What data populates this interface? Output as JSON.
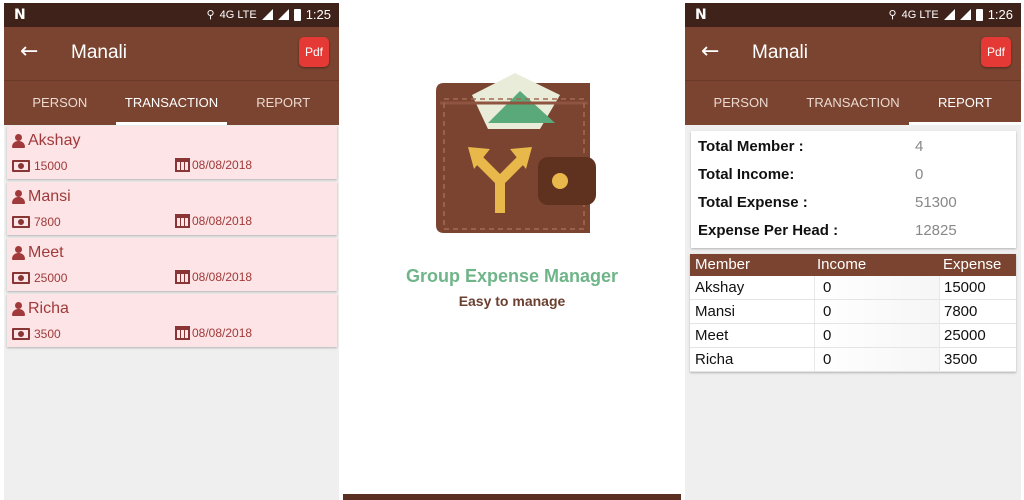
{
  "left": {
    "status": {
      "network": "4G LTE",
      "time": "1:25"
    },
    "title": "Manali",
    "pdf_label": "Pdf",
    "tabs": [
      "PERSON",
      "TRANSACTION",
      "REPORT"
    ],
    "active_tab": "TRANSACTION",
    "transactions": [
      {
        "name": "Akshay",
        "amount": "15000",
        "date": "08/08/2018"
      },
      {
        "name": "Mansi",
        "amount": "7800",
        "date": "08/08/2018"
      },
      {
        "name": "Meet",
        "amount": "25000",
        "date": "08/08/2018"
      },
      {
        "name": "Richa",
        "amount": "3500",
        "date": "08/08/2018"
      }
    ]
  },
  "middle": {
    "app_name": "Group Expense Manager",
    "tagline": "Easy to manage",
    "colors": {
      "wallet": "#7a4430",
      "arrow": "#e8b84b",
      "bill": "#5aa97a"
    }
  },
  "right": {
    "status": {
      "network": "4G LTE",
      "time": "1:26"
    },
    "title": "Manali",
    "pdf_label": "Pdf",
    "tabs": [
      "PERSON",
      "TRANSACTION",
      "REPORT"
    ],
    "active_tab": "REPORT",
    "summary": [
      {
        "label": "Total Member :",
        "value": "4"
      },
      {
        "label": "Total Income:",
        "value": "0"
      },
      {
        "label": "Total Expense :",
        "value": "51300"
      },
      {
        "label": "Expense Per Head :",
        "value": "12825"
      }
    ],
    "table": {
      "headers": [
        "Member",
        "Income",
        "Expense"
      ],
      "rows": [
        [
          "Akshay",
          "0",
          "15000"
        ],
        [
          "Mansi",
          "0",
          "7800"
        ],
        [
          "Meet",
          "0",
          "25000"
        ],
        [
          "Richa",
          "0",
          "3500"
        ]
      ]
    }
  },
  "colors": {
    "status_bar": "#3f2219",
    "app_bar": "#7a4430",
    "card": "#fde4e6",
    "pdf": "#e53935",
    "accent_green": "#6fb589"
  }
}
